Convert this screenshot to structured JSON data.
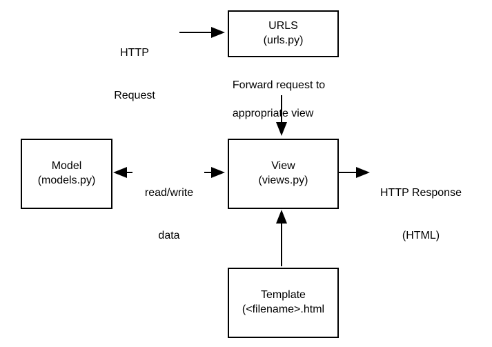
{
  "nodes": {
    "http_request": {
      "line1": "HTTP",
      "line2": "Request"
    },
    "urls": {
      "line1": "URLS",
      "line2": "(urls.py)"
    },
    "model": {
      "line1": "Model",
      "line2": "(models.py)"
    },
    "view": {
      "line1": "View",
      "line2": "(views.py)"
    },
    "template": {
      "line1": "Template",
      "line2": "(<filename>.html"
    },
    "http_response": {
      "line1": "HTTP Response",
      "line2": "(HTML)"
    }
  },
  "edges": {
    "forward": {
      "line1": "Forward request to",
      "line2": "appropriate view"
    },
    "rw_data": {
      "line1": "read/write",
      "line2": "data"
    }
  }
}
